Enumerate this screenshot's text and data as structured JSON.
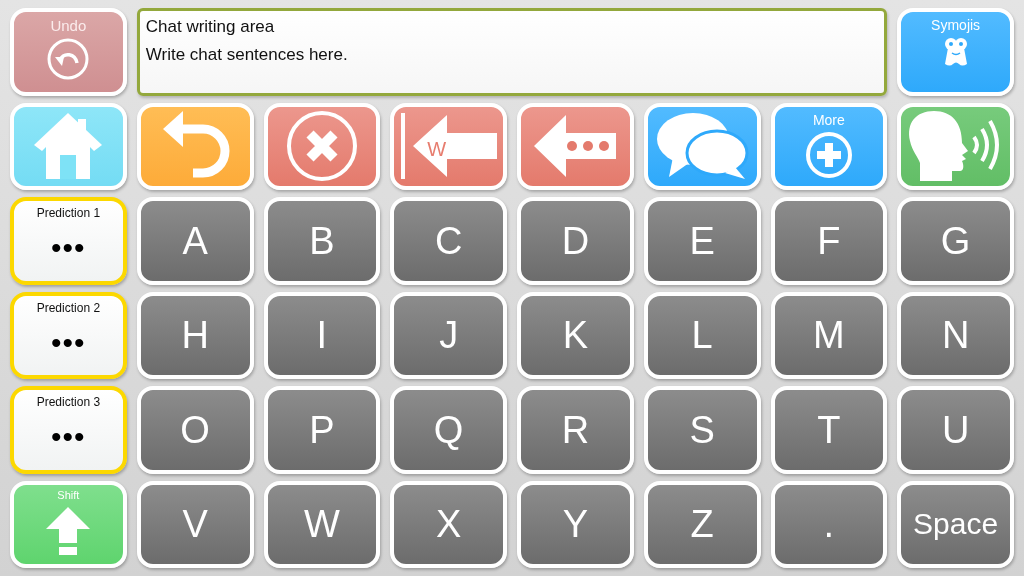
{
  "undo": {
    "label": "Undo"
  },
  "chat_area": {
    "title": "Chat writing area",
    "text": "Write chat sentences here."
  },
  "symojis": {
    "label": "Symojis"
  },
  "actions": [
    {
      "kind": "home"
    },
    {
      "kind": "back"
    },
    {
      "kind": "clear"
    },
    {
      "kind": "delete_word",
      "letter": "W"
    },
    {
      "kind": "delete_char"
    },
    {
      "kind": "chat"
    },
    {
      "kind": "more",
      "label": "More"
    },
    {
      "kind": "speak"
    }
  ],
  "predictions": [
    {
      "label": "Prediction 1",
      "value": "•••"
    },
    {
      "label": "Prediction 2",
      "value": "•••"
    },
    {
      "label": "Prediction 3",
      "value": "•••"
    }
  ],
  "shift": {
    "label": "Shift"
  },
  "keys": [
    [
      "A",
      "B",
      "C",
      "D",
      "E",
      "F",
      "G"
    ],
    [
      "H",
      "I",
      "J",
      "K",
      "L",
      "M",
      "N"
    ],
    [
      "O",
      "P",
      "Q",
      "R",
      "S",
      "T",
      "U"
    ],
    [
      "V",
      "W",
      "X",
      "Y",
      "Z",
      ".",
      "Space"
    ]
  ]
}
